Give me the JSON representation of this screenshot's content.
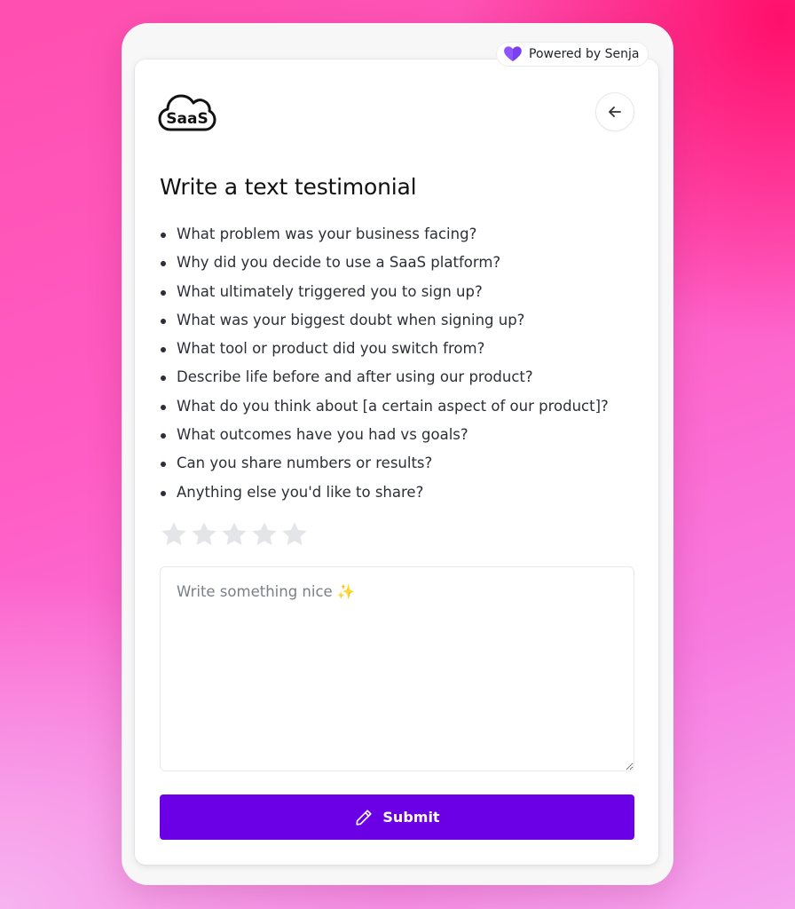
{
  "brand": {
    "powered_by": "Powered by Senja",
    "logo_text": "SaaS"
  },
  "header": {
    "back_icon": "arrow-left-icon"
  },
  "form": {
    "title": "Write a text testimonial",
    "questions": [
      "What problem was your business facing?",
      "Why did you decide to use a SaaS platform?",
      "What ultimately triggered you to sign up?",
      "What was your biggest doubt when signing up?",
      "What tool or product did you switch from?",
      "Describe life before and after using our product?",
      "What do you think about [a certain aspect of our product]?",
      "What outcomes have you had vs goals?",
      "Can you share numbers or results?",
      "Anything else you'd like to share?"
    ],
    "rating": {
      "max": 5,
      "value": 0
    },
    "textarea": {
      "placeholder": "Write something nice ✨",
      "value": ""
    },
    "submit_label": "Submit"
  },
  "colors": {
    "accent": "#6b00e6",
    "heart": "#7b3ff2",
    "star_empty": "#e4e5e8"
  }
}
